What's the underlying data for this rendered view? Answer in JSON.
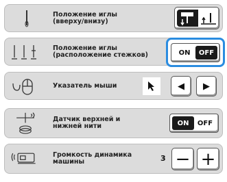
{
  "settings": {
    "needle_position": {
      "label": "Положение иглы\n(вверху/внизу)",
      "up_icon": "needle-up-icon",
      "down_icon": "needle-down-icon"
    },
    "needle_stop": {
      "label": "Положение иглы\n(расположение стежков)",
      "on_label": "ON",
      "off_label": "OFF",
      "value": "OFF"
    },
    "mouse_pointer": {
      "label": "Указатель мыши",
      "left_label": "◀",
      "right_label": "▶"
    },
    "thread_sensor": {
      "label": "Датчик верхней и\nнижней нити",
      "on_label": "ON",
      "off_label": "OFF",
      "value": "ON"
    },
    "speaker_volume": {
      "label": "Громкость динамика\nмашины",
      "value": "3",
      "minus_label": "−",
      "plus_label": "+"
    }
  },
  "colors": {
    "row_bg": "#dcdcdc",
    "highlight": "#2a8ce0",
    "active": "#1a1a1a"
  }
}
